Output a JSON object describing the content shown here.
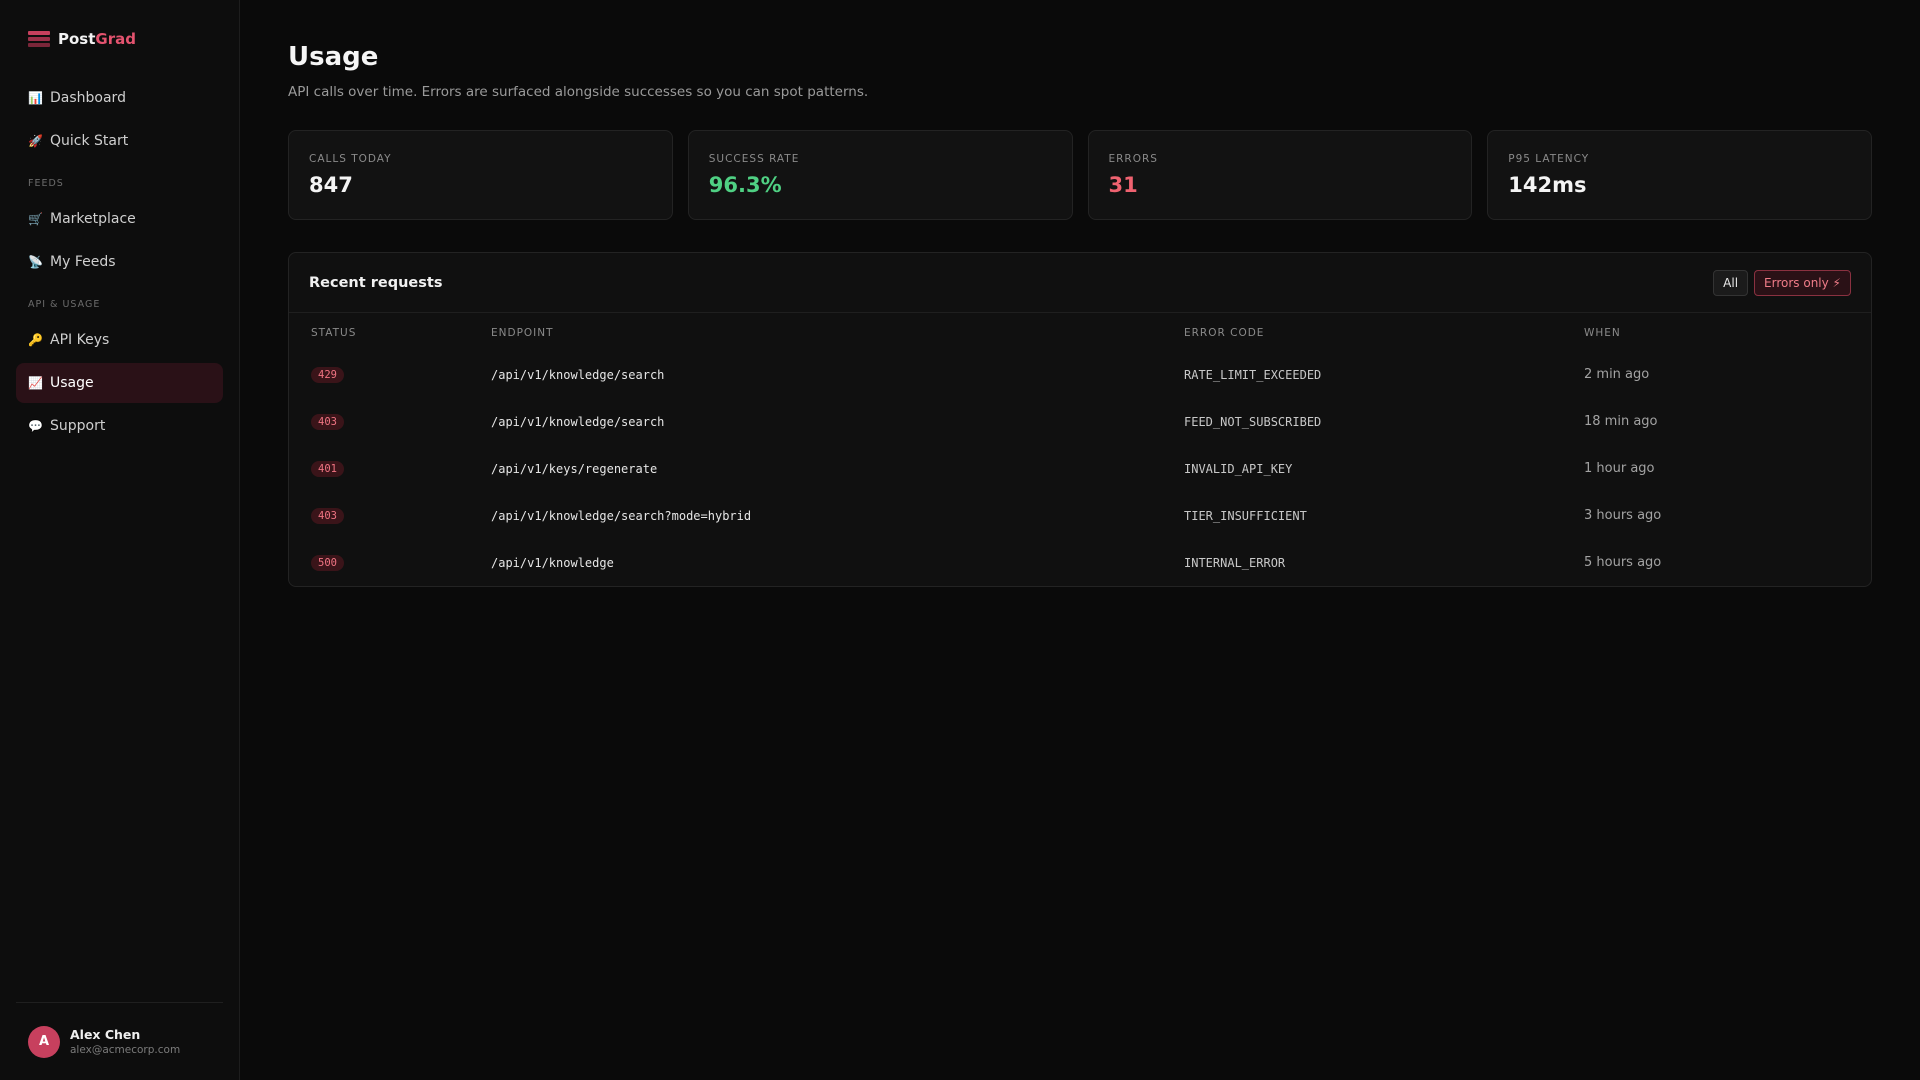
{
  "brand": {
    "name_primary": "Post",
    "name_accent": "Grad"
  },
  "sidebar": {
    "items_top": [
      {
        "icon": "📊",
        "label": "Dashboard"
      },
      {
        "icon": "🚀",
        "label": "Quick Start"
      }
    ],
    "section_feeds": "FEEDS",
    "items_feeds": [
      {
        "icon": "🛒",
        "label": "Marketplace"
      },
      {
        "icon": "📡",
        "label": "My Feeds"
      }
    ],
    "section_api": "API & USAGE",
    "items_api": [
      {
        "icon": "🔑",
        "label": "API Keys"
      },
      {
        "icon": "📈",
        "label": "Usage"
      },
      {
        "icon": "💬",
        "label": "Support"
      }
    ],
    "active_item": "Usage"
  },
  "user": {
    "initial": "A",
    "name": "Alex Chen",
    "email": "alex@acmecorp.com"
  },
  "page": {
    "title": "Usage",
    "subtitle": "API calls over time. Errors are surfaced alongside successes so you can spot patterns."
  },
  "stats": [
    {
      "label": "CALLS TODAY",
      "value": "847",
      "tone": "default"
    },
    {
      "label": "SUCCESS RATE",
      "value": "96.3%",
      "tone": "green"
    },
    {
      "label": "ERRORS",
      "value": "31",
      "tone": "red"
    },
    {
      "label": "P95 LATENCY",
      "value": "142ms",
      "tone": "default"
    }
  ],
  "requests": {
    "title": "Recent requests",
    "filter_all": "All",
    "filter_errors": "Errors only ⚡",
    "columns": {
      "status": "STATUS",
      "endpoint": "ENDPOINT",
      "error_code": "ERROR CODE",
      "when": "WHEN"
    },
    "rows": [
      {
        "status": "429",
        "endpoint": "/api/v1/knowledge/search",
        "error_code": "RATE_LIMIT_EXCEEDED",
        "when": "2 min ago"
      },
      {
        "status": "403",
        "endpoint": "/api/v1/knowledge/search",
        "error_code": "FEED_NOT_SUBSCRIBED",
        "when": "18 min ago"
      },
      {
        "status": "401",
        "endpoint": "/api/v1/keys/regenerate",
        "error_code": "INVALID_API_KEY",
        "when": "1 hour ago"
      },
      {
        "status": "403",
        "endpoint": "/api/v1/knowledge/search?mode=hybrid",
        "error_code": "TIER_INSUFFICIENT",
        "when": "3 hours ago"
      },
      {
        "status": "500",
        "endpoint": "/api/v1/knowledge",
        "error_code": "INTERNAL_ERROR",
        "when": "5 hours ago"
      }
    ]
  },
  "colors": {
    "accent": "#c7405e",
    "success": "#4fd083",
    "error": "#ef6270",
    "background": "#0a0a0a"
  }
}
